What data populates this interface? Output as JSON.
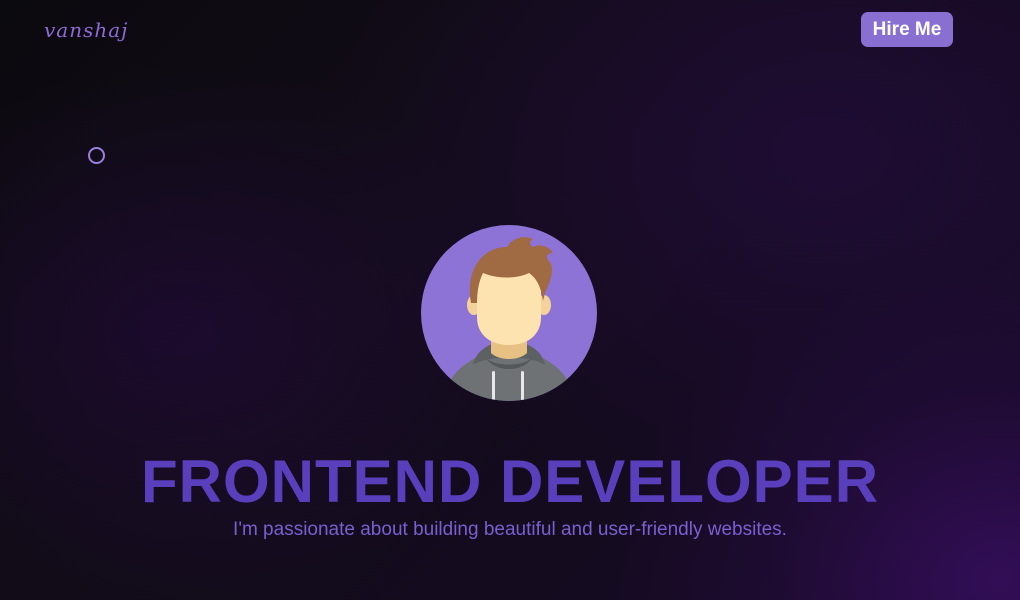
{
  "header": {
    "logo_text": "vanshaj",
    "hire_button_label": "Hire Me"
  },
  "hero": {
    "avatar_icon": "developer-avatar-icon",
    "headline": "FRONTEND DEVELOPER",
    "tagline": "I'm passionate about building beautiful and user-friendly websites."
  },
  "colors": {
    "accent": "#8a6fd3",
    "headline": "#5a3fbd",
    "tagline": "#7a5fd0",
    "background": "#0f0b15"
  }
}
